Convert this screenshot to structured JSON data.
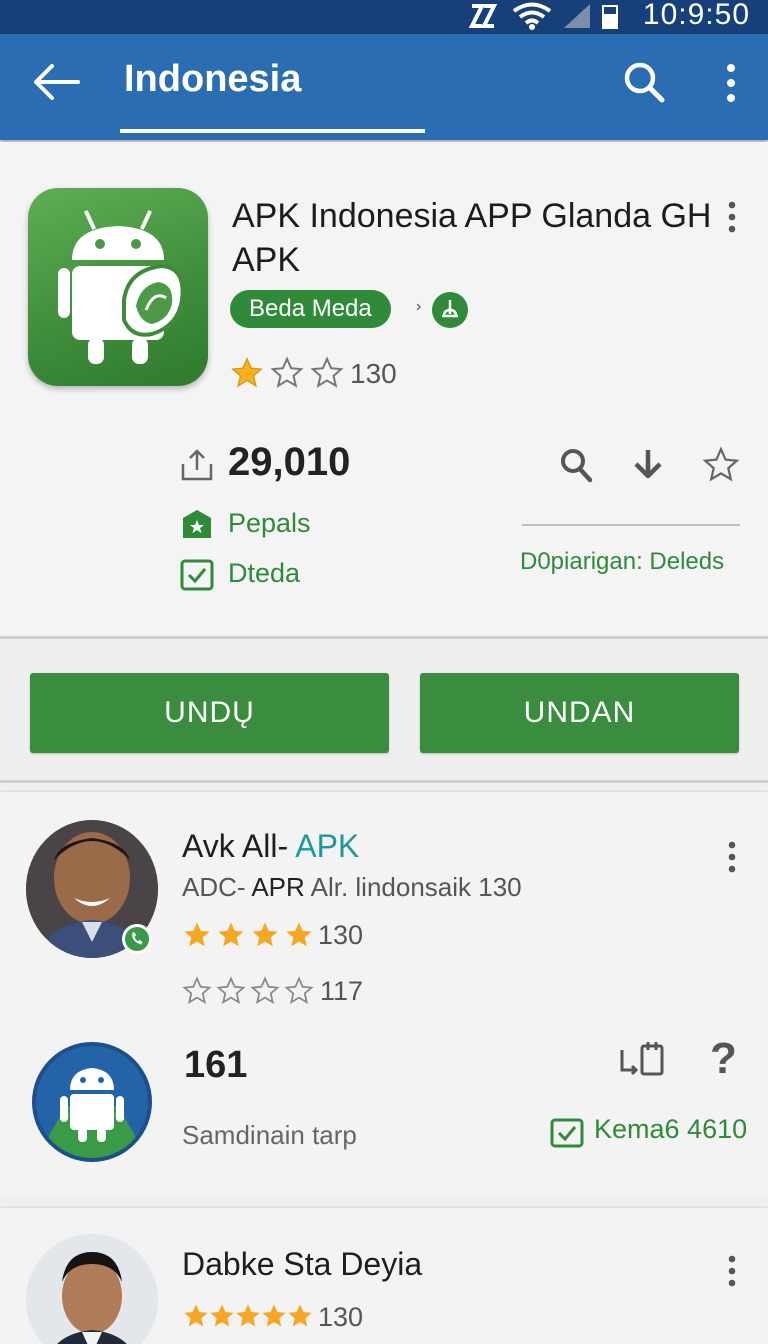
{
  "status_bar": {
    "time": "10:9:50",
    "icons": [
      "nfc-icon",
      "wifi-icon",
      "signal-icon",
      "battery-icon"
    ]
  },
  "app_bar": {
    "title": "Indonesia",
    "icons": [
      "back-arrow-icon",
      "search-icon",
      "more-vert-icon"
    ]
  },
  "featured_app": {
    "title": "APK Indonesia APP Glanda GH APK",
    "category_pill": "Beda Meda",
    "rating": {
      "filled_stars": 1,
      "total_stars": 3,
      "count": "130"
    },
    "downloads": "29,010",
    "tag_primary": "Pepals",
    "tag_secondary": "Dteda",
    "developer": "D0piarigan: Deleds",
    "actions": [
      "search-icon",
      "download-icon",
      "star-outline-icon"
    ]
  },
  "buttons": {
    "primary": "UNDŲ",
    "secondary": "UNDAN"
  },
  "list_item_1": {
    "title_main": "Avk All- ",
    "title_accent": "APK",
    "subtitle_prefix": "ADC- ",
    "subtitle_bold": "APR",
    "subtitle_rest": " Alr.  lindonsaik 130",
    "rating_a": {
      "filled_stars": 4,
      "count": "130"
    },
    "rating_b": {
      "filled_stars": 0,
      "count": "117"
    },
    "count": "161",
    "meta": "Samdinain tarp",
    "tag": "Kema6 4610"
  },
  "list_item_2": {
    "title": "Dabke Sta Deyia",
    "rating": {
      "filled_stars": 5,
      "count": "130"
    }
  },
  "colors": {
    "app_bar": "#2a6db3",
    "status_bar": "#173f7a",
    "accent_green": "#3a8c3f",
    "star": "#f5a623"
  }
}
